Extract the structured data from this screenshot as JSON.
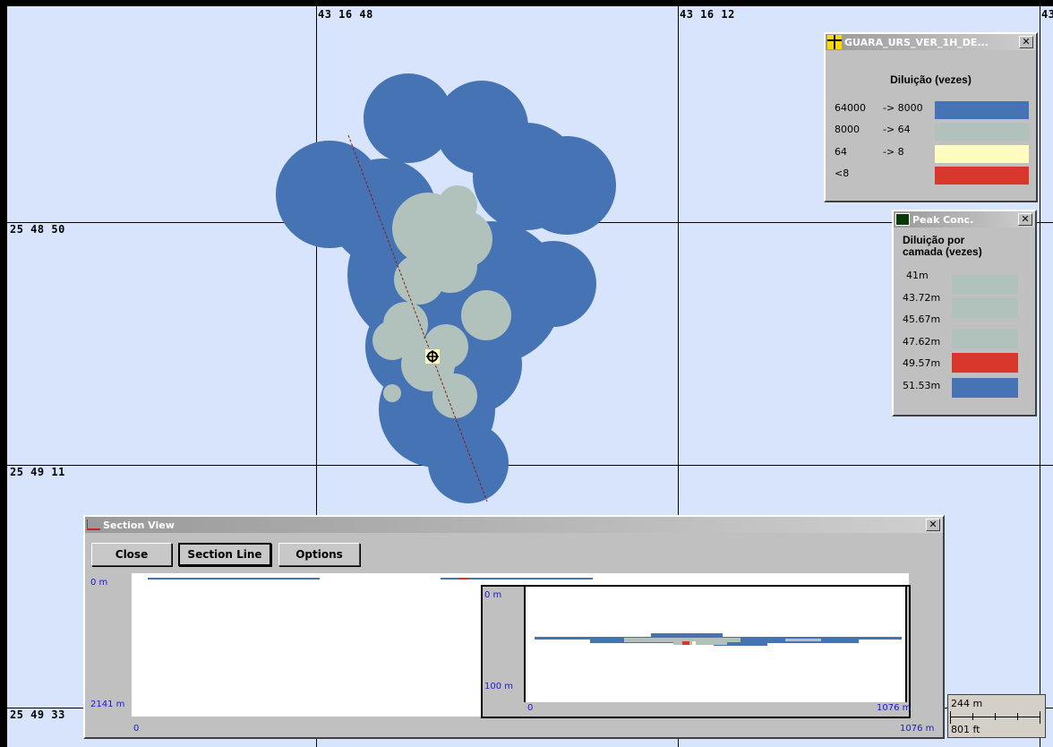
{
  "map": {
    "longitude_labels": [
      "43 16 48",
      "43 16 12",
      "43"
    ],
    "latitude_labels": [
      "25 48 50",
      "25 49 11",
      "25 49 33"
    ],
    "colors": {
      "background": "#d8e4fb",
      "dark_blue": "#4673b4",
      "gray_green": "#b1c2bd",
      "yellow": "#fffcc0",
      "red": "#d9372b"
    }
  },
  "dilution_legend": {
    "title": "GUARA_URS_VER_1H_DE...",
    "heading": "Diluição (vezes)",
    "rows": [
      {
        "from": "64000",
        "to": "-> 8000",
        "color": "#4673b4"
      },
      {
        "from": "8000",
        "to": "-> 64",
        "color": "#b1c2bd"
      },
      {
        "from": "64",
        "to": "-> 8",
        "color": "#fffcc0"
      },
      {
        "from": "<8",
        "to": "",
        "color": "#d9372b"
      }
    ]
  },
  "peak_conc": {
    "title": "Peak Conc.",
    "heading_line1": "Diluição por",
    "heading_line2": "camada (vezes)",
    "depths": [
      "41m",
      "43.72m",
      "45.67m",
      "47.62m",
      "49.57m",
      "51.53m"
    ],
    "layer_colors": [
      "#b1c2bd",
      "#b1c2bd",
      "#b1c2bd",
      "#d9372b",
      "#4673b4"
    ]
  },
  "section_view": {
    "title": "Section View",
    "buttons": {
      "close": "Close",
      "section_line": "Section Line",
      "options": "Options"
    },
    "main_plot": {
      "depth_top": "0 m",
      "depth_bottom": "2141 m",
      "x_start": "0",
      "x_end": "1076 m"
    },
    "inset_plot": {
      "depth_top": "0 m",
      "depth_bottom": "100 m",
      "x_start": "0",
      "x_end": "1076 m"
    }
  },
  "scale_bar": {
    "meters": "244 m",
    "feet": "801 ft"
  }
}
